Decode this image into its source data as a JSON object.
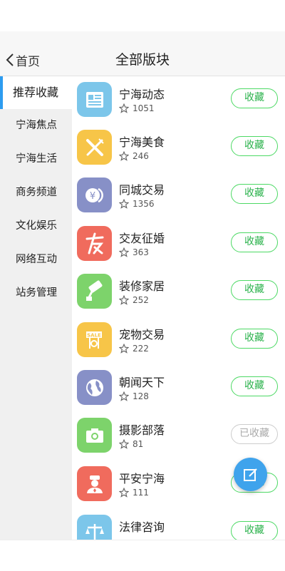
{
  "nav": {
    "back_label": "首页",
    "title": "全部版块"
  },
  "sidebar": {
    "items": [
      {
        "label": "推荐收藏",
        "active": true
      },
      {
        "label": "宁海焦点"
      },
      {
        "label": "宁海生活"
      },
      {
        "label": "商务频道"
      },
      {
        "label": "文化娱乐"
      },
      {
        "label": "网络互动"
      },
      {
        "label": "站务管理"
      }
    ]
  },
  "forums": [
    {
      "name": "宁海动态",
      "count": "1051",
      "button": "收藏",
      "icon": "news-icon",
      "color": "#7cc6ea"
    },
    {
      "name": "宁海美食",
      "count": "246",
      "button": "收藏",
      "icon": "fork-knife-icon",
      "color": "#f7c548"
    },
    {
      "name": "同城交易",
      "count": "1356",
      "button": "收藏",
      "icon": "yen-coin-icon",
      "color": "#8790c7"
    },
    {
      "name": "交友征婚",
      "count": "363",
      "button": "收藏",
      "icon": "friend-char-icon",
      "color": "#f06b5d"
    },
    {
      "name": "装修家居",
      "count": "252",
      "button": "收藏",
      "icon": "paint-roller-icon",
      "color": "#7dd36b"
    },
    {
      "name": "宠物交易",
      "count": "222",
      "button": "收藏",
      "icon": "sale-sign-icon",
      "color": "#f7c548"
    },
    {
      "name": "朝闻天下",
      "count": "128",
      "button": "收藏",
      "icon": "globe-icon",
      "color": "#8790c7"
    },
    {
      "name": "摄影部落",
      "count": "81",
      "button": "已收藏",
      "icon": "camera-icon",
      "color": "#7dd36b",
      "done": true
    },
    {
      "name": "平安宁海",
      "count": "111",
      "button": "收藏",
      "icon": "police-icon",
      "color": "#f06b5d"
    },
    {
      "name": "法律咨询",
      "count": "",
      "button": "收藏",
      "icon": "scales-icon",
      "color": "#7cc6ea"
    }
  ],
  "fab": {
    "icon": "edit-icon"
  }
}
